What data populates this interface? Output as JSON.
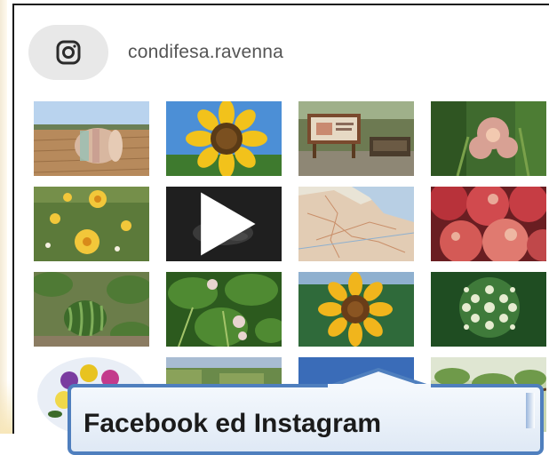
{
  "profile": {
    "username": "condifesa.ravenna",
    "avatar_icon": "instagram-icon"
  },
  "grid": {
    "tiles": [
      {
        "subject": "hay bale in field",
        "video": false
      },
      {
        "subject": "sunflower",
        "video": false
      },
      {
        "subject": "park sign",
        "video": false
      },
      {
        "subject": "pink flower",
        "video": false
      },
      {
        "subject": "yellow flowers",
        "video": false
      },
      {
        "subject": "dark video",
        "video": true
      },
      {
        "subject": "map",
        "video": false
      },
      {
        "subject": "apples",
        "video": false
      },
      {
        "subject": "watermelon",
        "video": false
      },
      {
        "subject": "bean plants",
        "video": false
      },
      {
        "subject": "sunflower",
        "video": false
      },
      {
        "subject": "white umbel flower",
        "video": false
      },
      {
        "subject": "flowers bouquet",
        "video": false
      },
      {
        "subject": "aerial landscape",
        "video": false
      },
      {
        "subject": "sky",
        "video": false
      },
      {
        "subject": "branch",
        "video": false
      }
    ]
  },
  "callout": {
    "title": "Facebook ed Instagram"
  },
  "colors": {
    "callout_border": "#4f7fbe",
    "frame_border": "#1a1a1a",
    "username": "#555555"
  }
}
